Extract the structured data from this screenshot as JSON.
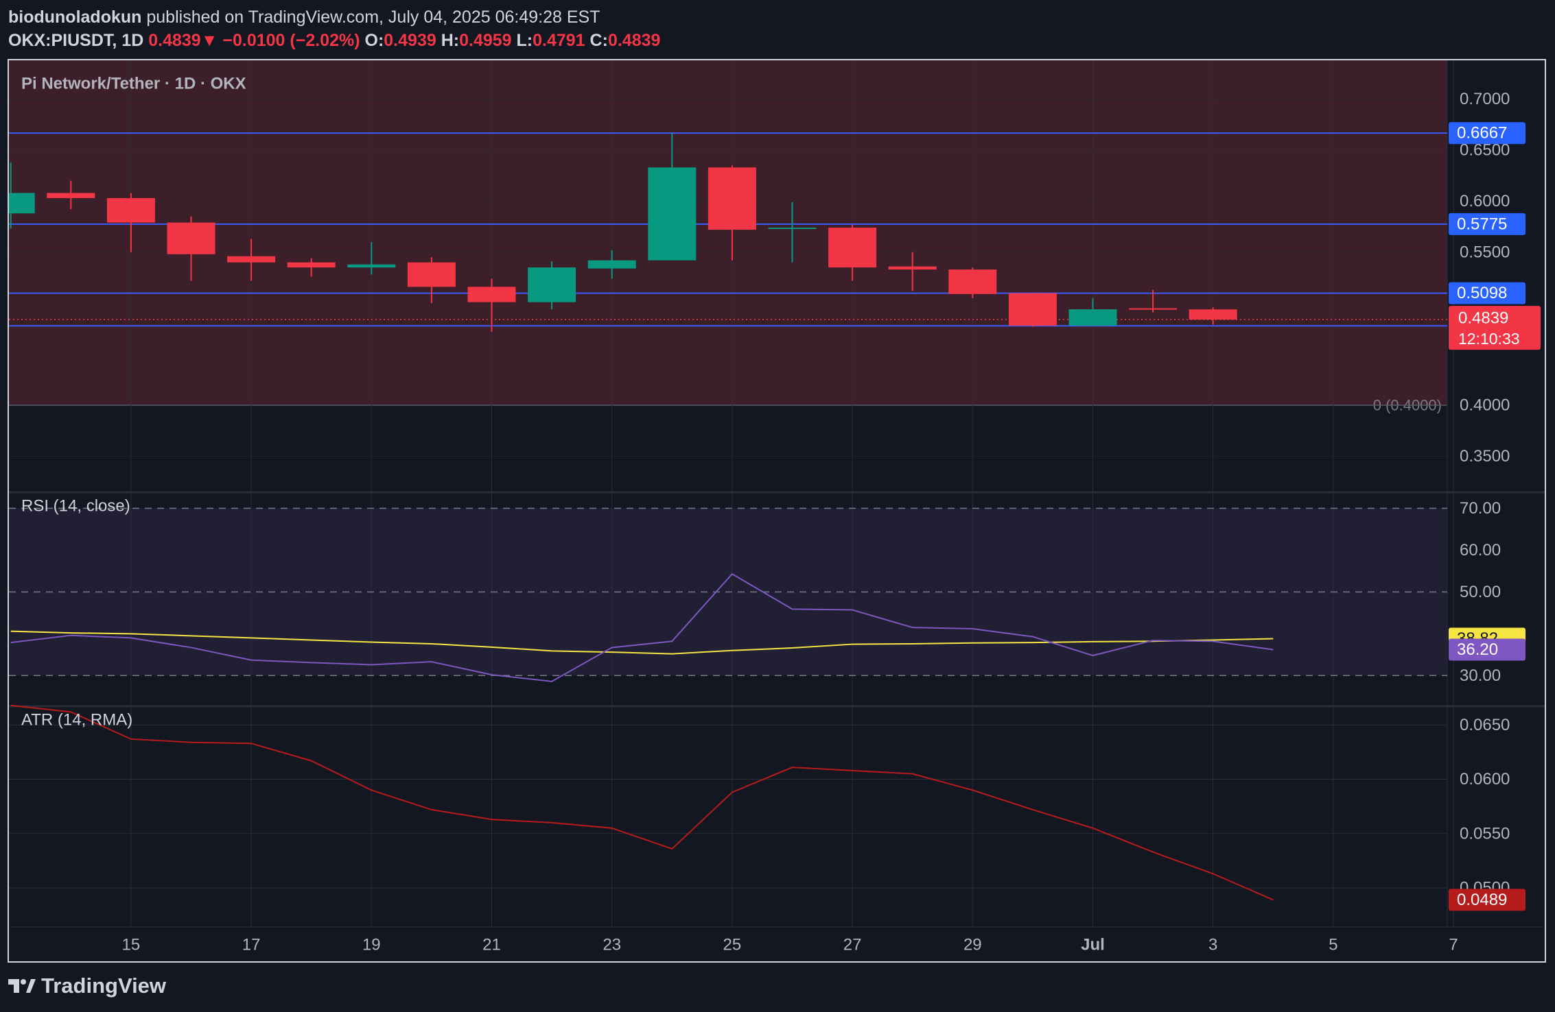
{
  "header": {
    "publisher": "biodunoladokun",
    "published_text": "published on TradingView.com, July 04, 2025 06:49:28 EST",
    "symbol": "OKX:PIUSDT, 1D",
    "last": "0.4839",
    "change_arrow": "▼",
    "change": "−0.0100 (−2.02%)",
    "o_label": "O:",
    "o": "0.4939",
    "h_label": "H:",
    "h": "0.4959",
    "l_label": "L:",
    "l": "0.4791",
    "c_label": "C:",
    "c": "0.4839"
  },
  "footer": {
    "brand": "TradingView"
  },
  "colors": {
    "up": "#089981",
    "down": "#f23645",
    "hline": "#3d5afe",
    "zone": "#3d1f2a",
    "rsi_line": "#7e57c2",
    "rsi_ma": "#f7e543",
    "atr": "#b71c1c"
  },
  "chart_data": [
    {
      "type": "candlestick",
      "title": "Pi Network/Tether · 1D · OKX",
      "x_ticks": [
        "15",
        "17",
        "19",
        "21",
        "23",
        "25",
        "27",
        "29",
        "Jul",
        "3",
        "5",
        "7"
      ],
      "x_tick_index": [
        2,
        4,
        6,
        8,
        10,
        12,
        14,
        16,
        18,
        20,
        22,
        24
      ],
      "y_ticks": [
        "0.7000",
        "0.6500",
        "0.6000",
        "0.5500",
        "0.4000",
        "0.3500"
      ],
      "y_tick_values": [
        0.7,
        0.65,
        0.6,
        0.55,
        0.4,
        0.35
      ],
      "ylim": [
        0.316,
        0.738
      ],
      "candles": [
        {
          "o": 0.588,
          "h": 0.638,
          "l": 0.573,
          "c": 0.608
        },
        {
          "o": 0.608,
          "h": 0.62,
          "l": 0.592,
          "c": 0.603
        },
        {
          "o": 0.603,
          "h": 0.608,
          "l": 0.55,
          "c": 0.579
        },
        {
          "o": 0.579,
          "h": 0.585,
          "l": 0.522,
          "c": 0.548
        },
        {
          "o": 0.546,
          "h": 0.563,
          "l": 0.522,
          "c": 0.54
        },
        {
          "o": 0.54,
          "h": 0.544,
          "l": 0.526,
          "c": 0.535
        },
        {
          "o": 0.535,
          "h": 0.56,
          "l": 0.528,
          "c": 0.538
        },
        {
          "o": 0.54,
          "h": 0.545,
          "l": 0.5,
          "c": 0.516
        },
        {
          "o": 0.516,
          "h": 0.524,
          "l": 0.472,
          "c": 0.501
        },
        {
          "o": 0.501,
          "h": 0.541,
          "l": 0.494,
          "c": 0.535
        },
        {
          "o": 0.534,
          "h": 0.552,
          "l": 0.524,
          "c": 0.542
        },
        {
          "o": 0.542,
          "h": 0.6667,
          "l": 0.542,
          "c": 0.633
        },
        {
          "o": 0.633,
          "h": 0.635,
          "l": 0.542,
          "c": 0.572
        },
        {
          "o": 0.574,
          "h": 0.599,
          "l": 0.54,
          "c": 0.574
        },
        {
          "o": 0.574,
          "h": 0.577,
          "l": 0.522,
          "c": 0.535
        },
        {
          "o": 0.536,
          "h": 0.55,
          "l": 0.512,
          "c": 0.533
        },
        {
          "o": 0.533,
          "h": 0.535,
          "l": 0.505,
          "c": 0.509
        },
        {
          "o": 0.5098,
          "h": 0.5098,
          "l": 0.477,
          "c": 0.478
        },
        {
          "o": 0.478,
          "h": 0.505,
          "l": 0.4778,
          "c": 0.494
        },
        {
          "o": 0.495,
          "h": 0.513,
          "l": 0.491,
          "c": 0.4939
        },
        {
          "o": 0.4939,
          "h": 0.4959,
          "l": 0.4791,
          "c": 0.4839
        }
      ],
      "horizontal_levels": [
        0.6667,
        0.5775,
        0.5098,
        0.4778
      ],
      "level_labels": [
        "0.6667",
        "0.5775",
        "0.5098",
        "0.4778"
      ],
      "zone": {
        "top": 0.74,
        "bottom": 0.4,
        "label": "0 (0.4000)"
      },
      "last_price_label": "0.4839",
      "countdown": "12:10:33"
    },
    {
      "type": "line",
      "title": "RSI (14, close)",
      "y_ticks": [
        "70.00",
        "60.00",
        "50.00",
        "30.00"
      ],
      "y_tick_values": [
        70,
        60,
        50,
        30
      ],
      "ylim": [
        23,
        73.5
      ],
      "bands": [
        70,
        50,
        30
      ],
      "series": [
        {
          "name": "RSI",
          "values": [
            37.9,
            39.6,
            39.0,
            36.7,
            33.7,
            33.1,
            32.6,
            33.3,
            30.2,
            28.6,
            36.7,
            38.2,
            54.3,
            45.9,
            45.7,
            41.5,
            41.2,
            39.3,
            34.8,
            38.4,
            38.2,
            36.2
          ]
        },
        {
          "name": "RSI MA",
          "values": [
            40.6,
            40.2,
            40.0,
            39.5,
            39.0,
            38.5,
            38.0,
            37.6,
            36.8,
            35.9,
            35.6,
            35.2,
            36.0,
            36.6,
            37.5,
            37.6,
            37.8,
            37.9,
            38.1,
            38.2,
            38.5,
            38.82
          ]
        }
      ],
      "last_labels": [
        "38.82",
        "36.20"
      ]
    },
    {
      "type": "line",
      "title": "ATR (14, RMA)",
      "y_ticks": [
        "0.0650",
        "0.0600",
        "0.0550",
        "0.0500"
      ],
      "y_tick_values": [
        0.065,
        0.06,
        0.055,
        0.05
      ],
      "ylim": [
        0.0464,
        0.0666
      ],
      "series": [
        {
          "name": "ATR",
          "values": [
            0.0668,
            0.0662,
            0.0637,
            0.0634,
            0.0633,
            0.0617,
            0.059,
            0.0572,
            0.0563,
            0.056,
            0.0555,
            0.0536,
            0.0588,
            0.0611,
            0.0608,
            0.0605,
            0.059,
            0.0572,
            0.0555,
            0.0533,
            0.0513,
            0.0489
          ]
        }
      ],
      "last_labels": [
        "0.0489"
      ]
    }
  ]
}
